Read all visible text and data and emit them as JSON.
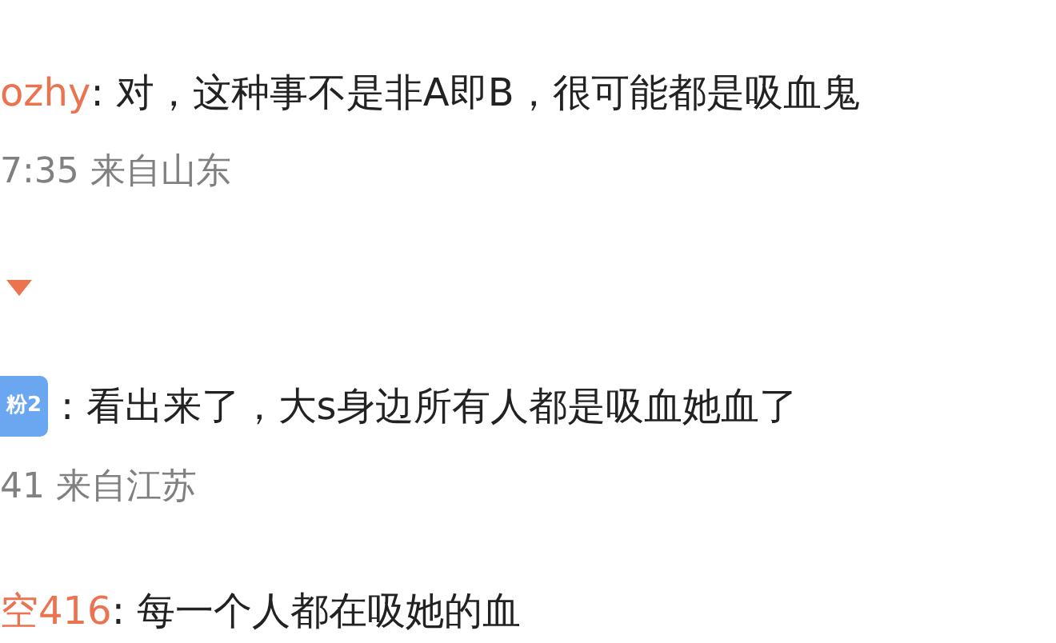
{
  "comments": [
    {
      "user": "ozhy",
      "text": ": 对，这种事不是非A即B，很可能都是吸血鬼",
      "meta": "7:35 来自山东",
      "replies_toggle": true
    },
    {
      "badge": "粉2",
      "text": ": 看出来了，大s身边所有人都是吸血她血了",
      "meta": "41 来自江苏",
      "replies_toggle": false
    },
    {
      "user": "空416",
      "text": ": 每一个人都在吸她的血",
      "replies_toggle": false
    }
  ]
}
